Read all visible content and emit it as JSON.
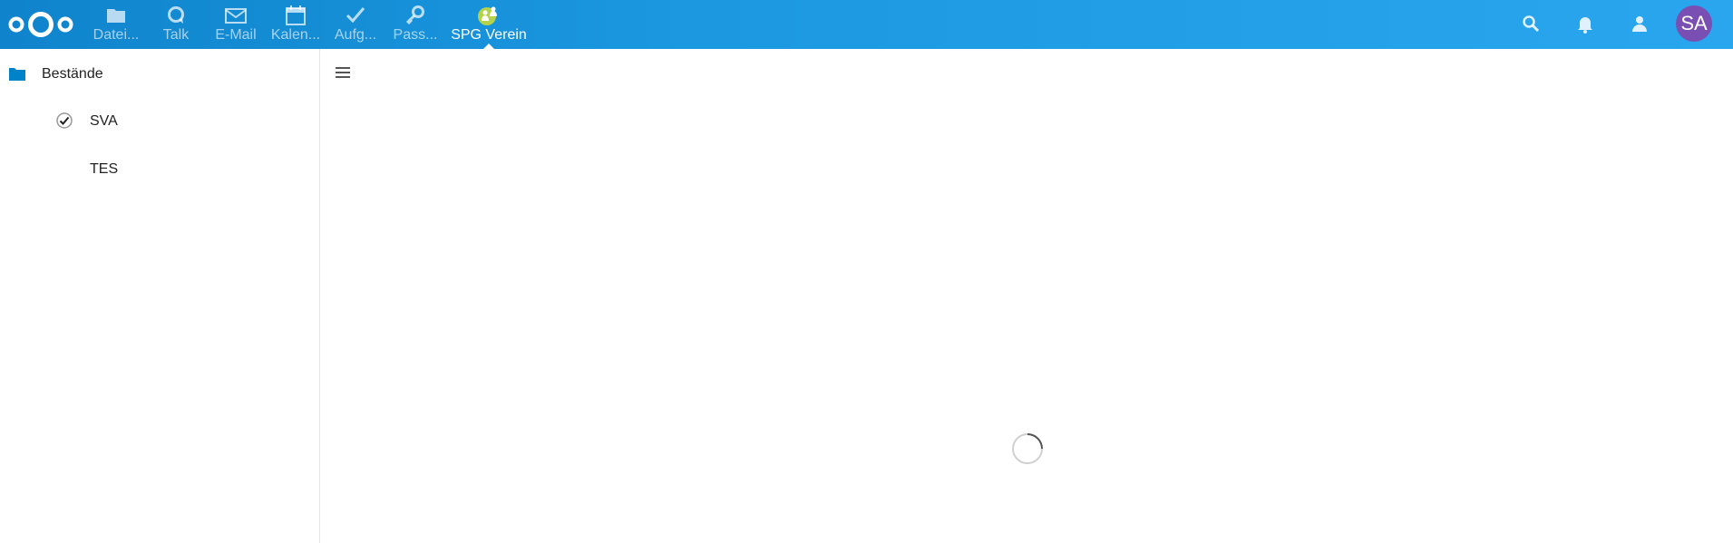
{
  "header": {
    "apps": [
      {
        "label": "Datei...",
        "icon": "folder-icon"
      },
      {
        "label": "Talk",
        "icon": "talk-icon"
      },
      {
        "label": "E-Mail",
        "icon": "mail-icon"
      },
      {
        "label": "Kalen...",
        "icon": "calendar-icon"
      },
      {
        "label": "Aufg...",
        "icon": "checkmark-icon"
      },
      {
        "label": "Pass...",
        "icon": "key-icon"
      },
      {
        "label": "SPG Verein",
        "icon": "people-icon"
      }
    ],
    "active_app": "SPG Verein",
    "user_initials": "SA",
    "colors": {
      "header": "#1b98e0",
      "avatar": "#7a4fb3",
      "accent": "#0082c9"
    }
  },
  "sidebar": {
    "section_title": "Bestände",
    "items": [
      {
        "label": "SVA",
        "icon": "checkmark-circle-icon"
      },
      {
        "label": "TES",
        "icon": ""
      }
    ]
  },
  "main": {
    "menu_icon": "hamburger-icon",
    "loading": true
  }
}
